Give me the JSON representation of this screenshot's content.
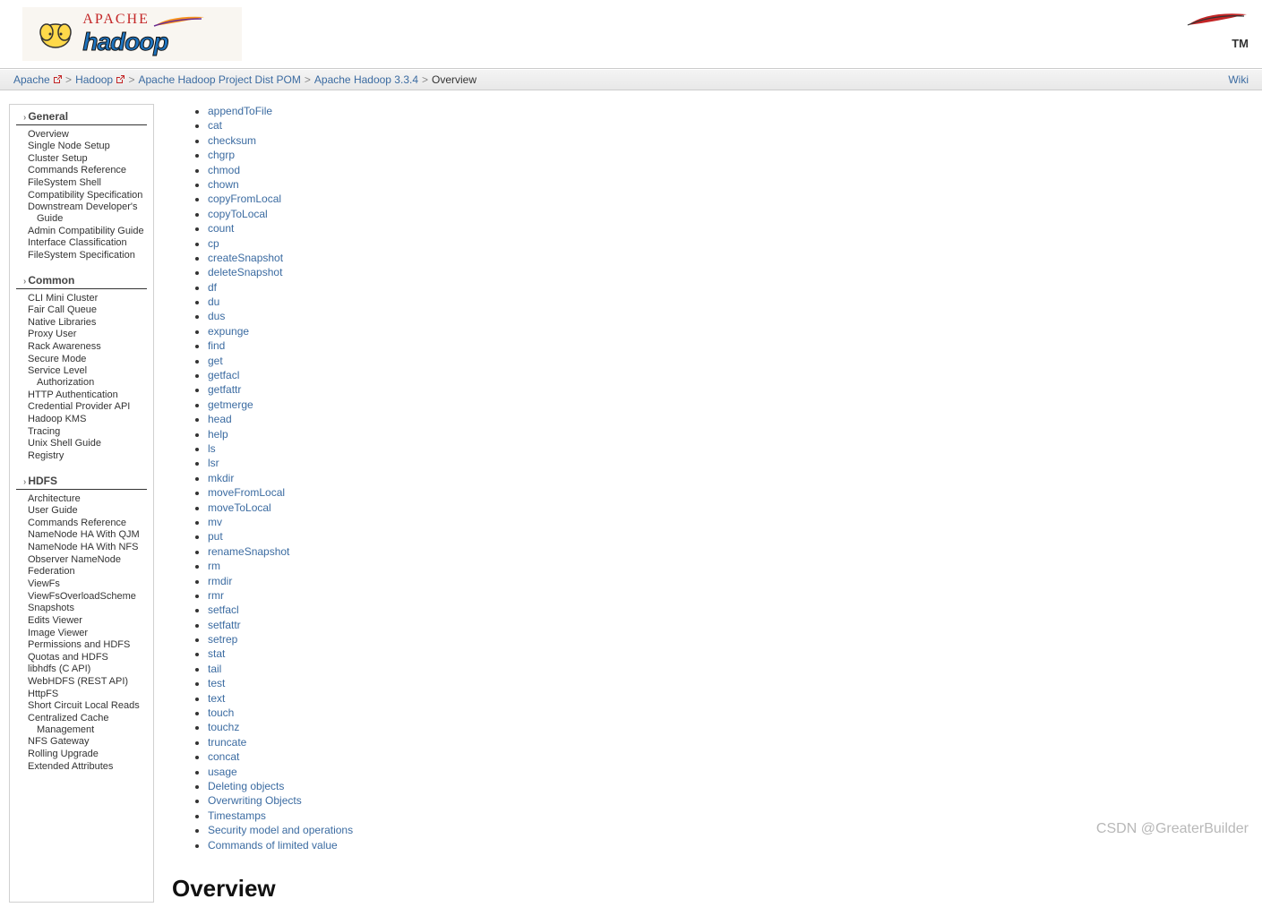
{
  "header": {
    "logo_line1": "APACHE",
    "logo_line2": "hadoop",
    "tm": "TM"
  },
  "breadcrumb": {
    "items": [
      {
        "label": "Apache",
        "ext": true
      },
      {
        "label": "Hadoop",
        "ext": true
      },
      {
        "label": "Apache Hadoop Project Dist POM",
        "ext": false
      },
      {
        "label": "Apache Hadoop 3.3.4",
        "ext": false
      }
    ],
    "current": "Overview",
    "right": "Wiki"
  },
  "sidebar": {
    "sections": [
      {
        "title": "General",
        "items": [
          "Overview",
          "Single Node Setup",
          "Cluster Setup",
          "Commands Reference",
          "FileSystem Shell",
          "Compatibility Specification",
          "Downstream Developer's Guide",
          "Admin Compatibility Guide",
          "Interface Classification",
          "FileSystem Specification"
        ]
      },
      {
        "title": "Common",
        "items": [
          "CLI Mini Cluster",
          "Fair Call Queue",
          "Native Libraries",
          "Proxy User",
          "Rack Awareness",
          "Secure Mode",
          "Service Level Authorization",
          "HTTP Authentication",
          "Credential Provider API",
          "Hadoop KMS",
          "Tracing",
          "Unix Shell Guide",
          "Registry"
        ]
      },
      {
        "title": "HDFS",
        "items": [
          "Architecture",
          "User Guide",
          "Commands Reference",
          "NameNode HA With QJM",
          "NameNode HA With NFS",
          "Observer NameNode",
          "Federation",
          "ViewFs",
          "ViewFsOverloadScheme",
          "Snapshots",
          "Edits Viewer",
          "Image Viewer",
          "Permissions and HDFS",
          "Quotas and HDFS",
          "libhdfs (C API)",
          "WebHDFS (REST API)",
          "HttpFS",
          "Short Circuit Local Reads",
          "Centralized Cache Management",
          "NFS Gateway",
          "Rolling Upgrade",
          "Extended Attributes"
        ]
      }
    ]
  },
  "main": {
    "commands": [
      "appendToFile",
      "cat",
      "checksum",
      "chgrp",
      "chmod",
      "chown",
      "copyFromLocal",
      "copyToLocal",
      "count",
      "cp",
      "createSnapshot",
      "deleteSnapshot",
      "df",
      "du",
      "dus",
      "expunge",
      "find",
      "get",
      "getfacl",
      "getfattr",
      "getmerge",
      "head",
      "help",
      "ls",
      "lsr",
      "mkdir",
      "moveFromLocal",
      "moveToLocal",
      "mv",
      "put",
      "renameSnapshot",
      "rm",
      "rmdir",
      "rmr",
      "setfacl",
      "setfattr",
      "setrep",
      "stat",
      "tail",
      "test",
      "text",
      "touch",
      "touchz",
      "truncate",
      "concat",
      "usage",
      "Deleting objects",
      "Overwriting Objects",
      "Timestamps",
      "Security model and operations",
      "Commands of limited value"
    ],
    "heading": "Overview"
  },
  "watermark": "CSDN @GreaterBuilder"
}
